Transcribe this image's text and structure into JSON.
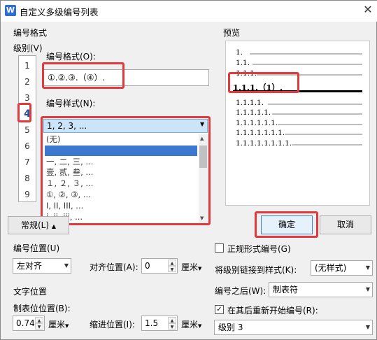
{
  "window": {
    "title": "自定义多级编号列表",
    "close_glyph": "✕",
    "app_icon_glyph": "W"
  },
  "numbering_format": {
    "group_title": "编号格式",
    "level_label": "级别(V)",
    "levels": [
      "1",
      "2",
      "3",
      "4",
      "5",
      "6",
      "7",
      "8",
      "9"
    ],
    "selected_level": "4",
    "format_label": "编号格式(O):",
    "format_value": "①.②.③.（④）.",
    "style_label": "编号样式(N):",
    "style_selected": "1, 2, 3, ...",
    "style_options": [
      "(无)",
      "1, 2, 3, ...",
      "一, 二, 三, ...",
      "壹, 贰, 叁, ...",
      "１, ２, ３, ...",
      "①, ②, ③, ...",
      "I, II, III, ...",
      "i, ii, iii, ..."
    ],
    "highlighted_option_index": 1
  },
  "preview": {
    "group_title": "预览",
    "lines": [
      "1.",
      "1.1.",
      "1.1.1.",
      "1.1.1.（1）.",
      "1.1.1.1.",
      "1.1.1.1.1.",
      "1.1.1.1.1.1.",
      "1.1.1.1.1.1.1.",
      "1.1.1.1.1.1.1.1."
    ]
  },
  "buttons": {
    "general": "常规(L)",
    "ok": "确定",
    "cancel": "取消"
  },
  "number_position": {
    "group_title": "编号位置(U)",
    "alignment_value": "左对齐",
    "align_at_label": "对齐位置(A):",
    "align_at_value": "0",
    "unit": "厘米"
  },
  "text_position": {
    "group_title": "文字位置",
    "tab_label": "制表位位置(B):",
    "tab_value": "0.74",
    "tab_unit": "厘米",
    "indent_label": "缩进位置(I):",
    "indent_value": "1.5",
    "indent_unit": "厘米"
  },
  "right_options": {
    "legal_style_label": "正规形式编号(G)",
    "legal_style_checked": false,
    "link_style_label": "将级别链接到样式(K):",
    "link_style_value": "(无样式)",
    "follow_label": "编号之后(W):",
    "follow_value": "制表符",
    "restart_label": "在其后重新开始编号(R):",
    "restart_checked": true,
    "restart_value": "级别 3"
  }
}
